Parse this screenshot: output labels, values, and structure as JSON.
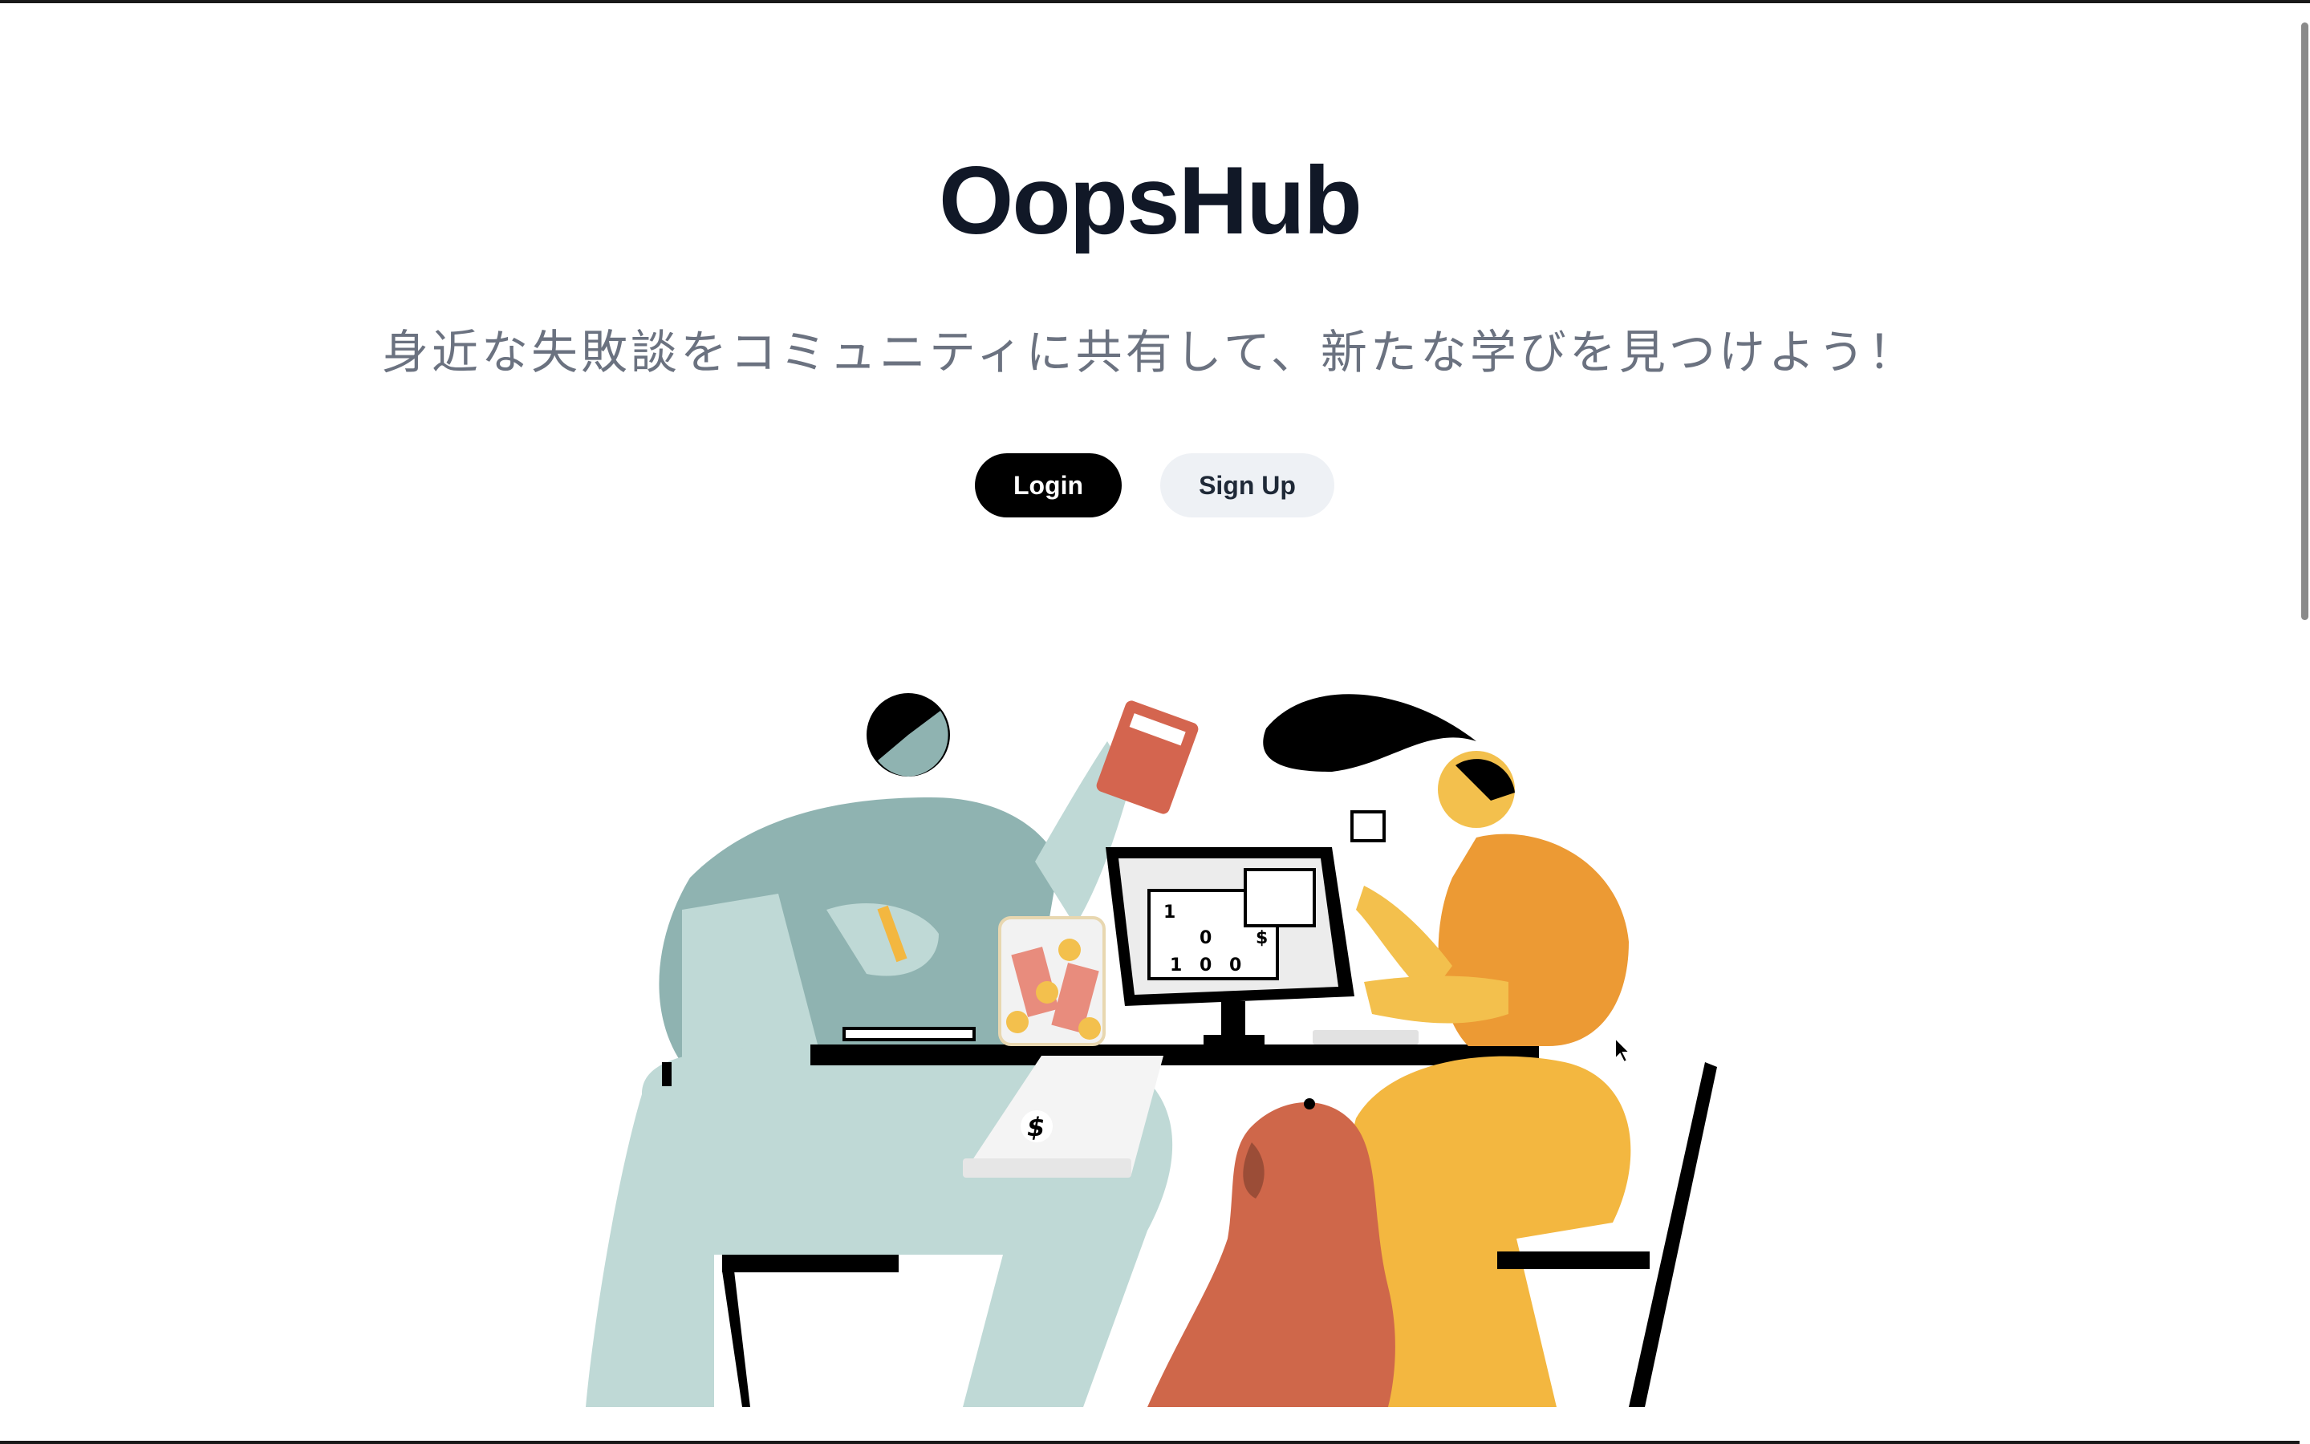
{
  "app": {
    "title": "OopsHub",
    "tagline": "身近な失敗談をコミュニティに共有して、新たな学びを見つけよう！"
  },
  "actions": {
    "login_label": "Login",
    "signup_label": "Sign Up"
  },
  "illustration": {
    "monitor_cells": [
      "1",
      "0",
      "$",
      "1",
      "0",
      "0"
    ],
    "receipt_symbol": "$"
  },
  "colors": {
    "title": "#111827",
    "subtitle": "#6b7280",
    "login_bg": "#000000",
    "signup_bg": "#eef1f5",
    "teal_person": "#8fb3b1",
    "teal_light": "#bfd9d6",
    "yellow_person": "#f3b740",
    "orange_shirt": "#ec9a34",
    "dog": "#cf674a",
    "calculator": "#d4654f"
  }
}
